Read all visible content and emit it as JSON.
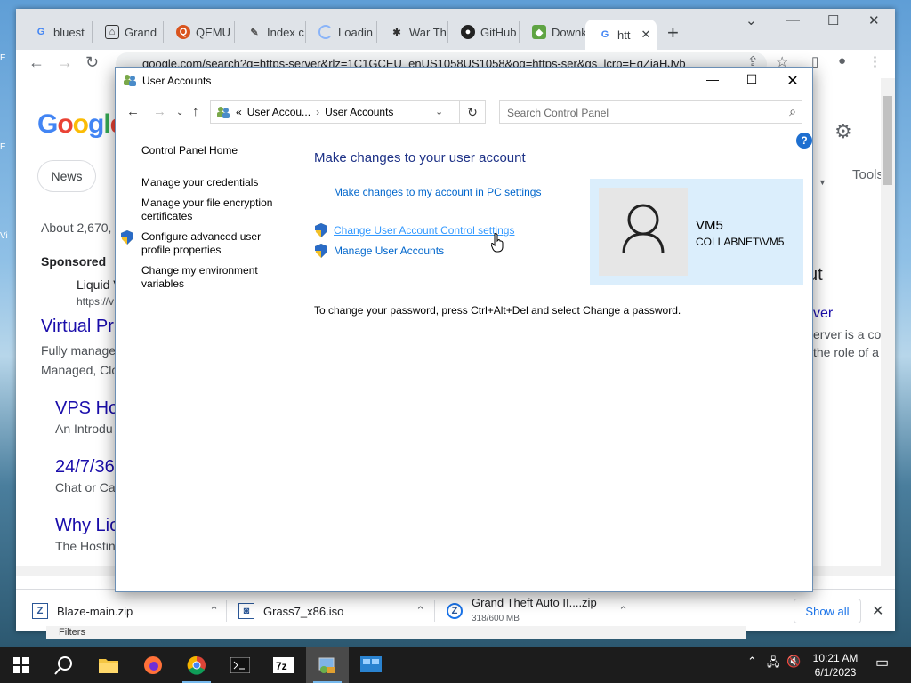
{
  "browser": {
    "tabs": [
      {
        "label": "bluest",
        "icon": "google-icon"
      },
      {
        "label": "Grand",
        "icon": "museum-icon"
      },
      {
        "label": "QEMU",
        "icon": "qemu-icon"
      },
      {
        "label": "Index c",
        "icon": "file-icon"
      },
      {
        "label": "Loadin",
        "icon": "loading-icon"
      },
      {
        "label": "War Th",
        "icon": "bug-icon"
      },
      {
        "label": "GitHub",
        "icon": "github-icon"
      },
      {
        "label": "Downk",
        "icon": "cube-icon"
      },
      {
        "label": "htt",
        "icon": "google-icon"
      }
    ],
    "url": "google.com/search?q=https-server&rlz=1C1GCEU_enUS1058US1058&oq=https-ser&gs_lcrp=EgZjaHJvb",
    "google": {
      "chip_news": "News",
      "results_count": "About 2,670,",
      "sponsored": "Sponsored",
      "ad_name": "Liquid V",
      "ad_url": "https://v",
      "result1_title": "Virtual Pr",
      "result1_line1": "Fully manage",
      "result1_line2": "Managed, Clo",
      "result2_title": "VPS Ho",
      "result2_sub": "An Introdu",
      "result3_title": "24/7/36",
      "result3_sub": "Chat or Cal",
      "result4_title": "Why Lio",
      "result4_sub": "The Hostin",
      "right_tools": "Tools",
      "right_about": "ut",
      "right_link": "ver",
      "right_text1": "erver is a co",
      "right_text2": "the role of a"
    },
    "downloads": [
      {
        "name": "Blaze-main.zip",
        "sub": ""
      },
      {
        "name": "Grass7_x86.iso",
        "sub": ""
      },
      {
        "name": "Grand Theft Auto II....zip",
        "sub": "318/600 MB"
      }
    ],
    "show_all": "Show all",
    "bottom_peek": "Filters"
  },
  "window": {
    "title": "User Accounts",
    "breadcrumb_prefix": "«",
    "breadcrumb_1": "User Accou...",
    "breadcrumb_2": "User Accounts",
    "search_placeholder": "Search Control Panel",
    "help": "?",
    "left_nav": {
      "home": "Control Panel Home",
      "credentials": "Manage your credentials",
      "encryption": "Manage your file encryption certificates",
      "advanced_profile": "Configure advanced user profile properties",
      "environment": "Change my environment variables"
    },
    "main": {
      "heading": "Make changes to your user account",
      "pc_settings_link": "Make changes to my account in PC settings",
      "uac_link": "Change User Account Control settings",
      "manage_link": "Manage User Accounts",
      "password_note": "To change your password, press Ctrl+Alt+Del and select Change a password."
    },
    "profile": {
      "name": "VM5",
      "domain": "COLLABNET\\VM5"
    }
  },
  "taskbar": {
    "clock_time": "10:21 AM",
    "clock_date": "6/1/2023"
  },
  "colors": {
    "link": "#0066cc",
    "heading": "#1e3287",
    "profile_bg": "#dbeefc",
    "taskbar": "#1c1c1c"
  }
}
